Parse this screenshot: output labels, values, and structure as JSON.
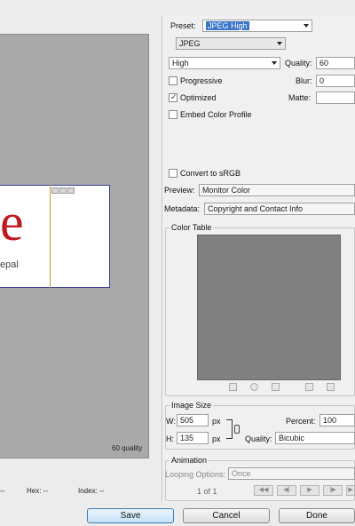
{
  "preview": {
    "logo_letter": "e",
    "logo_sub": "epal",
    "quality_text": "60 quality",
    "status": {
      "alpha": "-- ",
      "hex_label": "Hex: --",
      "index_label": "Index: --"
    }
  },
  "settings": {
    "preset_label": "Preset:",
    "preset_value": "JPEG High",
    "format_value": "JPEG",
    "quality_level": "High",
    "quality_label": "Quality:",
    "quality_value": "60",
    "progressive_label": "Progressive",
    "progressive_checked": false,
    "blur_label": "Blur:",
    "blur_value": "0",
    "optimized_label": "Optimized",
    "optimized_checked": true,
    "matte_label": "Matte:",
    "embed_profile_label": "Embed Color Profile",
    "embed_profile_checked": false,
    "convert_srgb_label": "Convert to sRGB",
    "convert_srgb_checked": false,
    "preview_label": "Preview:",
    "preview_value": "Monitor Color",
    "metadata_label": "Metadata:",
    "metadata_value": "Copyright and Contact Info"
  },
  "color_table": {
    "title": "Color Table",
    "swatch_color": "#808080"
  },
  "image_size": {
    "title": "Image Size",
    "width_label": "W:",
    "width_value": "505",
    "height_label": "H:",
    "height_value": "135",
    "unit": "px",
    "percent_label": "Percent:",
    "percent_value": "100",
    "quality_label": "Quality:",
    "quality_value": "Bicubic"
  },
  "animation": {
    "title": "Animation",
    "looping_label": "Looping Options:",
    "looping_value": "Once",
    "frame_counter": "1 of 1"
  },
  "buttons": {
    "save": "Save",
    "cancel": "Cancel",
    "done": "Done"
  }
}
